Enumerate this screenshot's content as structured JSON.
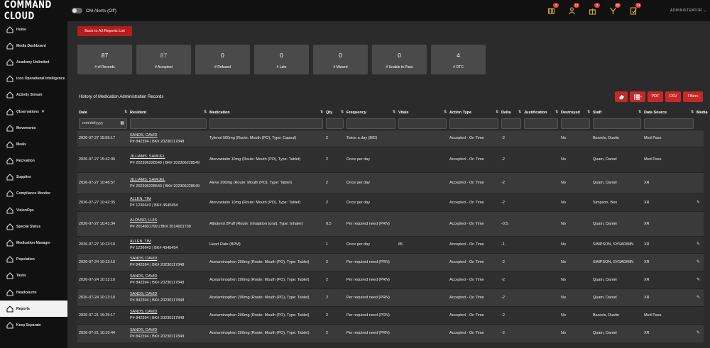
{
  "app": {
    "logo": "COMMAND CLOUD",
    "cm_alerts": "CM Alerts (Off)",
    "user": "ADMINISTRATOR",
    "user_chevron": "⌄"
  },
  "topbar_icons": [
    {
      "name": "alerts-icon",
      "badge": "3"
    },
    {
      "name": "users-alert-icon",
      "badge": "14"
    },
    {
      "name": "gift-icon",
      "badge": "2"
    },
    {
      "name": "compliance-icon",
      "badge": "60"
    },
    {
      "name": "tasks-icon",
      "badge": "74"
    }
  ],
  "sidebar": {
    "items": [
      {
        "label": "Home",
        "icon": "home-icon"
      },
      {
        "label": "Media Dashboard",
        "icon": "media-icon"
      },
      {
        "label": "Academy Unlimited",
        "icon": "academy-icon"
      },
      {
        "label": "icon Operational Intelligence",
        "icon": "oi-icon"
      },
      {
        "label": "Activity Stream",
        "icon": "stream-icon"
      },
      {
        "label": "Observations",
        "icon": "observations-icon",
        "chevron": "▾"
      },
      {
        "label": "Movements",
        "icon": "movements-icon"
      },
      {
        "label": "Meals",
        "icon": "meals-icon"
      },
      {
        "label": "Recreation",
        "icon": "recreation-icon"
      },
      {
        "label": "Supplies",
        "icon": "supplies-icon"
      },
      {
        "label": "Compliance Monitor",
        "icon": "compliance-icon"
      },
      {
        "label": "VisionOps",
        "icon": "visionops-icon"
      },
      {
        "label": "Special Status",
        "icon": "special-status-icon"
      },
      {
        "label": "Medication Manager",
        "icon": "medication-icon"
      },
      {
        "label": "Population",
        "icon": "population-icon"
      },
      {
        "label": "Tasks",
        "icon": "tasks-icon"
      },
      {
        "label": "Headcounts",
        "icon": "headcounts-icon"
      },
      {
        "label": "Reports",
        "icon": "reports-icon",
        "active": true
      },
      {
        "label": "Keep Separate",
        "icon": "keep-separate-icon"
      }
    ]
  },
  "main": {
    "back_button": "Back to All Reports List",
    "stats": [
      {
        "value": "87",
        "label": "# of Records"
      },
      {
        "value": "87",
        "label": "# Accepted"
      },
      {
        "value": "0",
        "label": "# Refused"
      },
      {
        "value": "0",
        "label": "# Late"
      },
      {
        "value": "0",
        "label": "# Missed"
      },
      {
        "value": "0",
        "label": "# Unable to Pass"
      },
      {
        "value": "4",
        "label": "# OTC"
      }
    ],
    "history_title": "History of Medication Administration Records",
    "toolbar": {
      "pdf": "PDF",
      "csv": "CSV",
      "filters": "Filters"
    },
    "date_filter_placeholder": "mm/dd/yyyy",
    "columns": [
      "Date",
      "Resident",
      "Medication",
      "Qty",
      "Frequency",
      "Vitals",
      "Action Type",
      "Delta",
      "Justification",
      "Destroyed",
      "Staff",
      "Data Source",
      "Media"
    ],
    "rows": [
      {
        "date": "2026-07-27 15:55:17",
        "res_name": "SANDS, DAVID",
        "res_id": "P# 842394 | BK# 20230117848",
        "med": "Tylenol 500mg (Route: Mouth (PO), Type: Capsul)",
        "qty": "2",
        "freq": "Twice a day (BID)",
        "vitals": "",
        "action": "Accepted - On Time",
        "delta": "-2",
        "just": "",
        "destroyed": "No",
        "staff": "Barvels, Dustin",
        "source": "Med Pass",
        "media": false
      },
      {
        "date": "2026-07-27 15:42:35",
        "res_name": "JILLIAMS, SAMUEL",
        "res_id": "P# 202306228549 | BK# 202306228549",
        "med": "Atorvastatin 10mg (Route: Mouth (PO), Type: Tablet)",
        "qty": "2",
        "freq": "Once per day",
        "vitals": "",
        "action": "Accepted - On Time",
        "delta": "-2",
        "just": "",
        "destroyed": "No",
        "staff": "Quam, Daniel",
        "source": "Med Pass",
        "media": false
      },
      {
        "date": "2026-07-27 10:46:57",
        "res_name": "JILLIAMS, SAMUEL",
        "res_id": "P# 202306228549 | BK# 202306228549",
        "med": "Aleve 200mg (Route: Mouth (PO), Type: Tablet)",
        "qty": "2",
        "freq": "Once per day",
        "vitals": "",
        "action": "Accepted - On Time",
        "delta": "-2",
        "just": "",
        "destroyed": "No",
        "staff": "Quam, Daniel",
        "source": "XR",
        "media": false
      },
      {
        "date": "2026-07-27 10:42:35",
        "res_name": "ALLEN, TIM",
        "res_id": "P# 1236643 | BK# 4545454",
        "med": "Atorvastatin 10mg (Route: Mouth (PO), Type: Tablet)",
        "qty": "2",
        "freq": "Once per day",
        "vitals": "",
        "action": "Accepted - On Time",
        "delta": "-2",
        "just": "",
        "destroyed": "No",
        "staff": "Simpson, Ben",
        "source": "XR",
        "media": true
      },
      {
        "date": "2026-07-27 10:41:34",
        "res_name": "ALONSO, LUIS",
        "res_id": "P# 2014001799 | BK# 2014001799",
        "med": "Albuterol 2Puff (Route: Inhalation (oral), Type: Inhaler)",
        "qty": "0.5",
        "freq": "Per required need (PRN)",
        "vitals": "",
        "action": "Accepted - On Time",
        "delta": "-0.5",
        "just": "",
        "destroyed": "No",
        "staff": "Quam, Daniel",
        "source": "XR",
        "media": false
      },
      {
        "date": "2026-07-27 10:13:10",
        "res_name": "ALLEN, TIM",
        "res_id": "P# 1236643 | BK# 4545454",
        "med": "Heart Rate (BPM)",
        "qty": "1",
        "freq": "Once per day",
        "vitals": "85",
        "action": "Accepted - On Time",
        "delta": "-1",
        "just": "",
        "destroyed": "No",
        "staff": "SIMPSON, SYSADMIN",
        "source": "XR",
        "media": true
      },
      {
        "date": "2026-07-24 10:13:10",
        "res_name": "SANDS, DAVID",
        "res_id": "P# 842394 | BK# 20230117848",
        "med": "Acetaminophen 200mg (Route: Mouth (PO), Type: Tablet)",
        "qty": "2",
        "freq": "Per required need (PRN)",
        "vitals": "",
        "action": "Accepted - On Time",
        "delta": "-2",
        "just": "",
        "destroyed": "No",
        "staff": "SIMPSON, SYSADMIN",
        "source": "XR",
        "media": true
      },
      {
        "date": "2026-07-24 10:13:10",
        "res_name": "SANDS, DAVID",
        "res_id": "P# 842394 | BK# 20230117848",
        "med": "Acetaminophen 200mg (Route: Mouth (PO), Type: Tablet)",
        "qty": "2",
        "freq": "Per required need (PRN)",
        "vitals": "",
        "action": "Accepted - On Time",
        "delta": "-2",
        "just": "",
        "destroyed": "No",
        "staff": "Quam, Daniel",
        "source": "XR",
        "media": true
      },
      {
        "date": "2026-07-24 10:13:10",
        "res_name": "SANDS, DAVID",
        "res_id": "P# 842394 | BK# 20230117848",
        "med": "Acetaminophen 200mg (Route: Mouth (PO), Type: Tablet)",
        "qty": "2",
        "freq": "Per required need (PRN)",
        "vitals": "",
        "action": "Accepted - On Time",
        "delta": "-2",
        "just": "",
        "destroyed": "No",
        "staff": "Quam, Daniel",
        "source": "XR",
        "media": true
      },
      {
        "date": "2026-07-21 15:25:17",
        "res_name": "SANDS, DAVID",
        "res_id": "P# 842394 | BK# 20230117848",
        "med": "Acetaminophen 200mg (Route: Mouth (PO), Type: Tablet)",
        "qty": "2",
        "freq": "Per required need (PRN)",
        "vitals": "",
        "action": "Accepted - On Time",
        "delta": "-2",
        "just": "",
        "destroyed": "No",
        "staff": "Barvels, Dustin",
        "source": "Med Pass",
        "media": false
      },
      {
        "date": "2026-07-21 10:10:44",
        "res_name": "SANDS, DAVID",
        "res_id": "P# 842394 | BK# 20230117848",
        "med": "Acetaminophen 200mg (Route: Mouth (PO), Type: Tablet)",
        "qty": "2",
        "freq": "Per required need (PRN)",
        "vitals": "",
        "action": "Accepted - On Time",
        "delta": "-2",
        "just": "",
        "destroyed": "No",
        "staff": "Quam, Daniel",
        "source": "XR",
        "media": true
      }
    ]
  }
}
